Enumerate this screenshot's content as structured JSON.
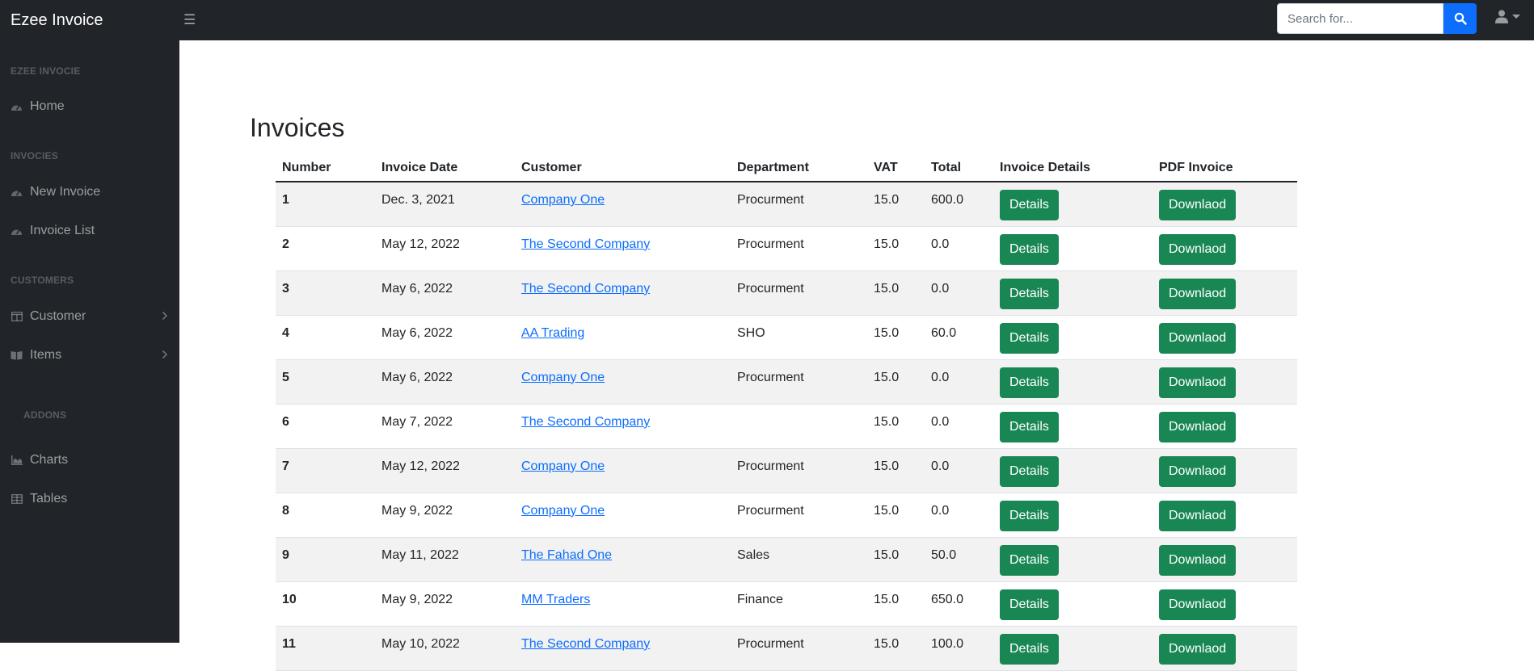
{
  "app": {
    "brand": "Ezee Invoice",
    "toggle_icon": "☰",
    "search_placeholder": "Search for...",
    "search_value": ""
  },
  "sidebar": {
    "sections": [
      {
        "heading": "EZEE INVOCIE"
      },
      {
        "heading": "INVOCIES"
      },
      {
        "heading": "CUSTOMERS"
      },
      {
        "heading": "ADDONS"
      }
    ],
    "items": [
      {
        "label": "Home",
        "icon": "tachometer-icon"
      },
      {
        "label": "New Invoice",
        "icon": "tachometer-icon"
      },
      {
        "label": "Invoice List",
        "icon": "tachometer-icon"
      },
      {
        "label": "Customer",
        "icon": "columns-icon"
      },
      {
        "label": "Items",
        "icon": "book-open-icon"
      },
      {
        "label": "Charts",
        "icon": "chart-area-icon"
      },
      {
        "label": "Tables",
        "icon": "table-icon"
      }
    ]
  },
  "main": {
    "title": "Invoices",
    "columns": [
      "Number",
      "Invoice Date",
      "Customer",
      "Department",
      "VAT",
      "Total",
      "Invoice Details",
      "PDF Invoice"
    ],
    "details_label": "Details",
    "download_label": "Downlaod",
    "rows": [
      {
        "number": "1",
        "date": "Dec. 3, 2021",
        "customer": "Company One",
        "department": "Procurment",
        "vat": "15.0",
        "total": "600.0"
      },
      {
        "number": "2",
        "date": "May 12, 2022",
        "customer": "The Second Company",
        "department": "Procurment",
        "vat": "15.0",
        "total": "0.0"
      },
      {
        "number": "3",
        "date": "May 6, 2022",
        "customer": "The Second Company",
        "department": "Procurment",
        "vat": "15.0",
        "total": "0.0"
      },
      {
        "number": "4",
        "date": "May 6, 2022",
        "customer": "AA Trading",
        "department": "SHO",
        "vat": "15.0",
        "total": "60.0"
      },
      {
        "number": "5",
        "date": "May 6, 2022",
        "customer": "Company One",
        "department": "Procurment",
        "vat": "15.0",
        "total": "0.0"
      },
      {
        "number": "6",
        "date": "May 7, 2022",
        "customer": "The Second Company",
        "department": "",
        "vat": "15.0",
        "total": "0.0"
      },
      {
        "number": "7",
        "date": "May 12, 2022",
        "customer": "Company One",
        "department": "Procurment",
        "vat": "15.0",
        "total": "0.0"
      },
      {
        "number": "8",
        "date": "May 9, 2022",
        "customer": "Company One",
        "department": "Procurment",
        "vat": "15.0",
        "total": "0.0"
      },
      {
        "number": "9",
        "date": "May 11, 2022",
        "customer": "The Fahad One",
        "department": "Sales",
        "vat": "15.0",
        "total": "50.0"
      },
      {
        "number": "10",
        "date": "May 9, 2022",
        "customer": "MM Traders",
        "department": "Finance",
        "vat": "15.0",
        "total": "650.0"
      },
      {
        "number": "11",
        "date": "May 10, 2022",
        "customer": "The Second Company",
        "department": "Procurment",
        "vat": "15.0",
        "total": "100.0"
      }
    ]
  },
  "colors": {
    "sidebar_bg": "#212529",
    "primary": "#0d6efd",
    "success": "#198754"
  }
}
